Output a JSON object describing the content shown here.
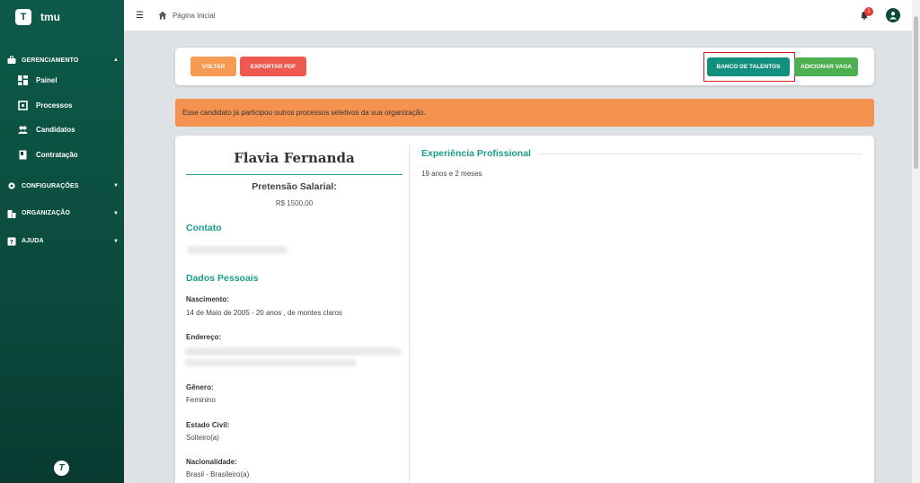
{
  "app": {
    "name": "tmu",
    "logo_letter": "T",
    "footer_logo": "T"
  },
  "sidebar": {
    "groups": [
      {
        "label": "GERENCIAMENTO",
        "icon": "briefcase-icon",
        "expanded": true,
        "items": [
          {
            "label": "Painel",
            "icon": "dashboard-icon"
          },
          {
            "label": "Processos",
            "icon": "process-icon"
          },
          {
            "label": "Candidatos",
            "icon": "people-icon"
          },
          {
            "label": "Contratação",
            "icon": "contract-icon"
          }
        ]
      },
      {
        "label": "CONFIGURAÇÕES",
        "icon": "gear-icon",
        "expanded": false
      },
      {
        "label": "ORGANIZAÇÃO",
        "icon": "building-icon",
        "expanded": false
      },
      {
        "label": "AJUDA",
        "icon": "help-icon",
        "expanded": false
      }
    ]
  },
  "topbar": {
    "breadcrumb": "Página Inicial",
    "notification_count": "1"
  },
  "actions": {
    "voltar": "VOLTAR",
    "exportar_pdf": "EXPORTAR PDF",
    "banco_talentos": "BANCO DE TALENTOS",
    "adicionar_vaga": "ADICIONAR VAGA"
  },
  "alert": {
    "text": "Esse candidato já participou outros processos seletivos da sua organização."
  },
  "candidate": {
    "name": "Flavia Fernanda",
    "salary_label": "Pretensão Salarial:",
    "salary_value": "R$ 1500,00",
    "contact_title": "Contato",
    "personal_title": "Dados Pessoais",
    "birth_label": "Nascimento:",
    "birth_value": "14 de Maio de 2005 - 20 anos , de montes claros",
    "address_label": "Endereço:",
    "gender_label": "Gênero:",
    "gender_value": "Feminino",
    "civil_label": "Estado Civil:",
    "civil_value": "Solteiro(a)",
    "nationality_label": "Nacionalidade:",
    "nationality_value": "Brasil - Brasileiro(a)"
  },
  "experience": {
    "title": "Experiência Profissional",
    "duration": "19 anos e 2 meses"
  },
  "colors": {
    "sidebar": "#0b4a3c",
    "accent": "#1c9c8a",
    "alert": "#f6924f",
    "voltar": "#f79a52",
    "pdf": "#f0574f",
    "banco": "#138f7e",
    "adicionar": "#4caf50"
  }
}
